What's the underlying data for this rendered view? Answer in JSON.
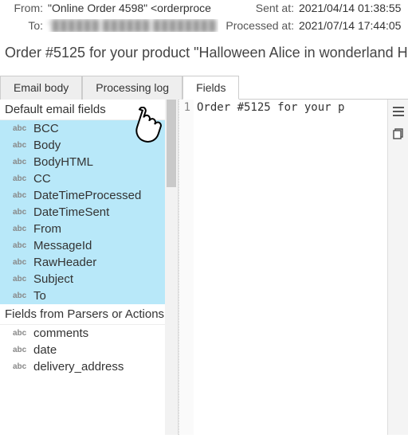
{
  "header": {
    "from_label": "From:",
    "from_value": "\"Online Order 4598\" <orderproce",
    "to_label": "To:",
    "to_value": "\"██████ ██████  ████████",
    "sent_label": "Sent at:",
    "sent_value": "2021/04/14 01:38:55",
    "processed_label": "Processed at:",
    "processed_value": "2021/07/14 17:44:05"
  },
  "subject": "Order #5125 for your product \"Halloween Alice in wonderland Ha",
  "tabs": {
    "email_body": "Email body",
    "processing_log": "Processing log",
    "fields": "Fields"
  },
  "left": {
    "default_header": "Default email fields",
    "parser_header": "Fields from Parsers or Actions",
    "abc": "abc",
    "default_fields": [
      "BCC",
      "Body",
      "BodyHTML",
      "CC",
      "DateTimeProcessed",
      "DateTimeSent",
      "From",
      "MessageId",
      "RawHeader",
      "Subject",
      "To"
    ],
    "parser_fields": [
      "comments",
      "date",
      "delivery_address"
    ]
  },
  "code": {
    "line_no": "1",
    "line_text": "Order #5125 for your p"
  }
}
